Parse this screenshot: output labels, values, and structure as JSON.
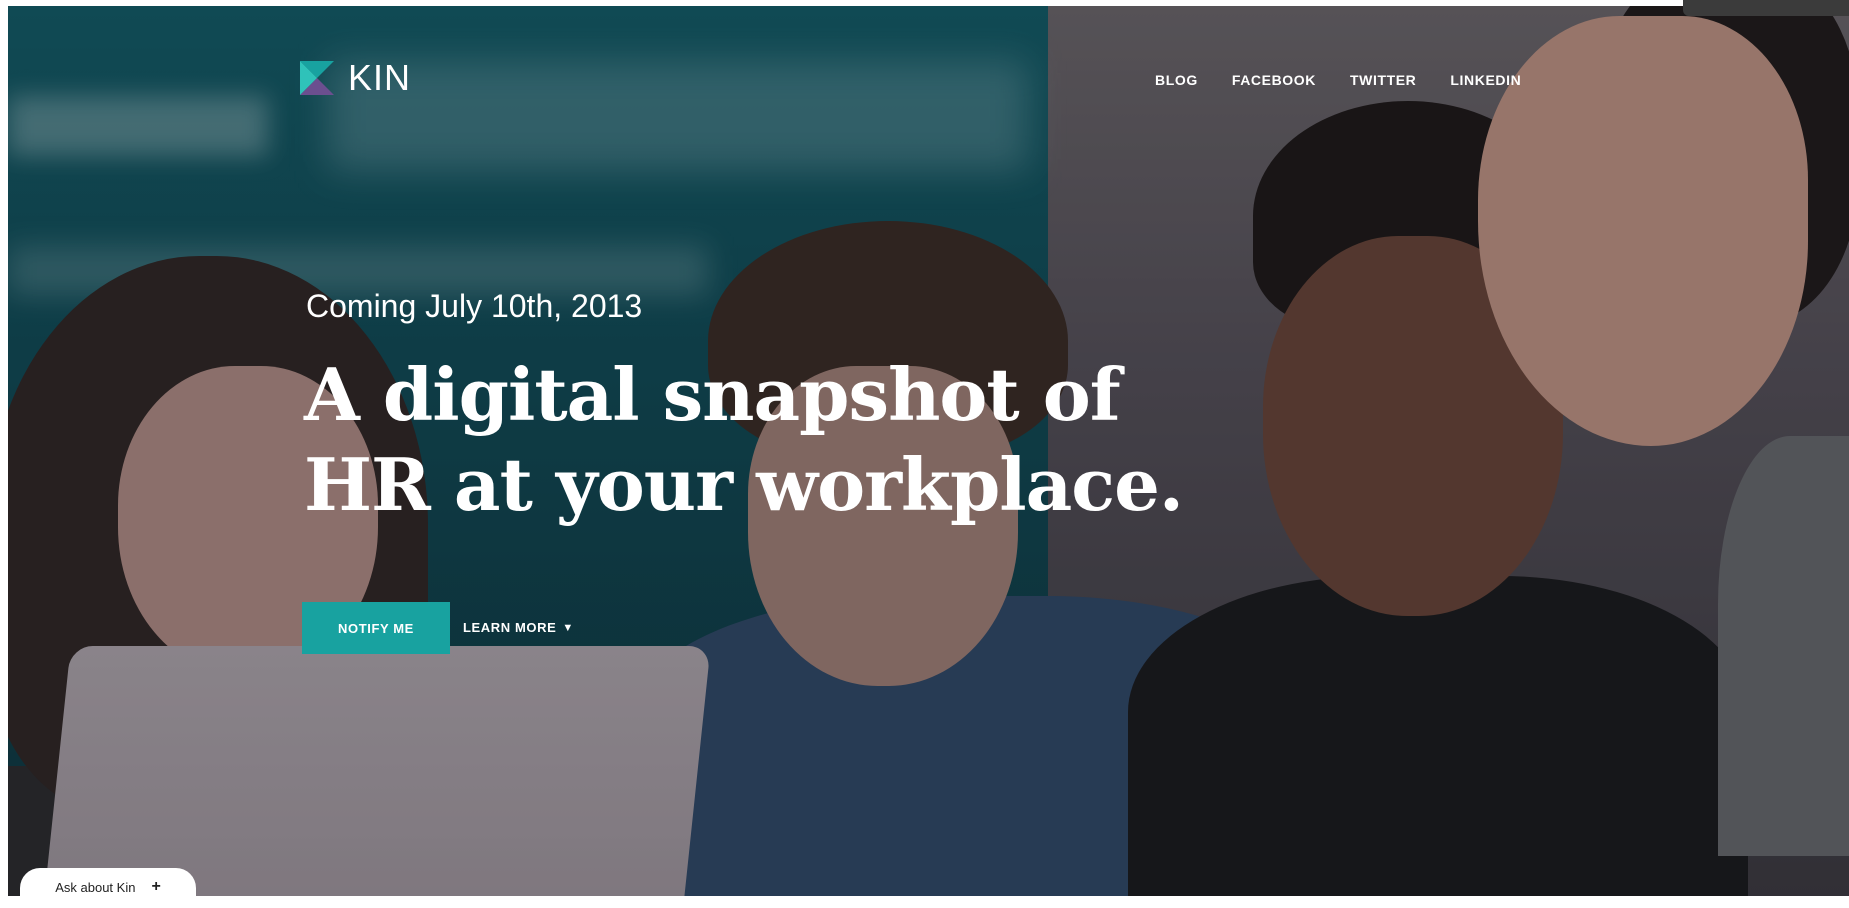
{
  "brand": {
    "name": "KIN",
    "accent": "#18a2a0",
    "logo_colors": [
      "#18a2a0",
      "#6b4f8f",
      "#2fc2b9"
    ]
  },
  "nav": {
    "items": [
      {
        "label": "BLOG"
      },
      {
        "label": "FACEBOOK"
      },
      {
        "label": "TWITTER"
      },
      {
        "label": "LINKEDIN"
      }
    ]
  },
  "hero": {
    "date_line": "Coming July 10th, 2013",
    "headline_line1": "A digital snapshot of",
    "headline_line2": "HR at your workplace.",
    "primary_cta": "NOTIFY ME",
    "secondary_cta": "LEARN MORE",
    "secondary_cta_icon": "arrow-down-icon"
  },
  "chat": {
    "label": "Ask about Kin",
    "icon": "plus-icon"
  }
}
